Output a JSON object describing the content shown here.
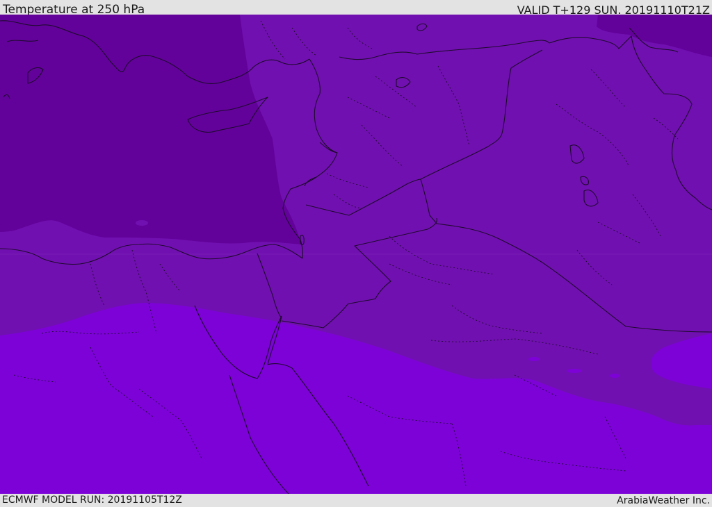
{
  "header": {
    "title": "Temperature at 250 hPa",
    "valid": "VALID T+129 SUN. 20191110T21Z"
  },
  "footer": {
    "model_run": "ECMWF MODEL RUN: 20191105T12Z",
    "credit": "ArabiaWeather Inc."
  },
  "colors": {
    "zone_dark": "#63029a",
    "zone_mid": "#7110b0",
    "zone_south": "#7d02d8",
    "borders": "#1e0a2e"
  }
}
